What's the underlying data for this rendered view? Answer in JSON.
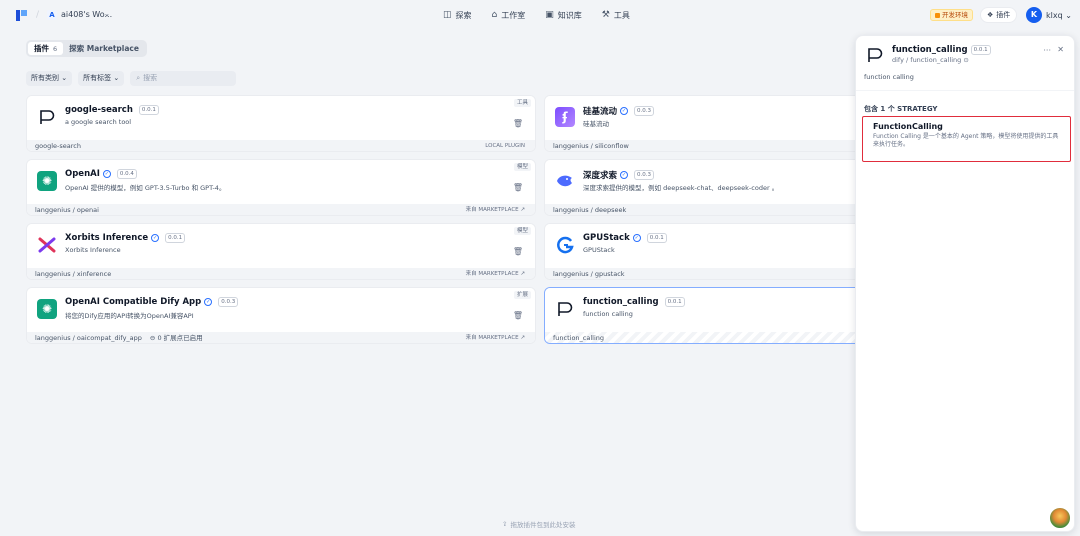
{
  "header": {
    "workspace_badge": "A",
    "workspace_name": "ai408's Wo...",
    "nav": [
      {
        "icon": "compass-icon",
        "label": "探索"
      },
      {
        "icon": "robot-icon",
        "label": "工作室"
      },
      {
        "icon": "book-icon",
        "label": "知识库"
      },
      {
        "icon": "tool-icon",
        "label": "工具"
      }
    ],
    "dev_env": "开发环境",
    "plugins_btn": "插件",
    "avatar_letter": "K",
    "username": "klxq"
  },
  "tabs": [
    {
      "label": "插件",
      "count": "6"
    },
    {
      "label": "探索 Marketplace",
      "count": ""
    }
  ],
  "filters": {
    "category": "所有类别",
    "tags": "所有标签",
    "search_placeholder": "搜索"
  },
  "cards": [
    {
      "title": "google-search",
      "version": "0.0.1",
      "verified": false,
      "desc": "a google search tool",
      "tag": "工具",
      "footer": "google-search",
      "source": "LOCAL PLUGIN",
      "icon": "p-logo-icon",
      "extra": ""
    },
    {
      "title": "硅基流动",
      "version": "0.0.3",
      "verified": true,
      "desc": "硅基流动",
      "tag": "",
      "footer": "langgenius / siliconflow",
      "source": "",
      "icon": "siliconflow-icon",
      "extra": ""
    },
    {
      "title": "OpenAI",
      "version": "0.0.4",
      "verified": true,
      "desc": "OpenAI 提供的模型，例如 GPT-3.5-Turbo 和 GPT-4。",
      "tag": "模型",
      "footer": "langgenius / openai",
      "source": "来自 MARKETPLACE ↗",
      "icon": "openai-icon",
      "extra": ""
    },
    {
      "title": "深度求索",
      "version": "0.0.3",
      "verified": true,
      "desc": "深度求索提供的模型，例如 deepseek-chat、deepseek-coder 。",
      "tag": "",
      "footer": "langgenius / deepseek",
      "source": "",
      "icon": "deepseek-icon",
      "extra": ""
    },
    {
      "title": "Xorbits Inference",
      "version": "0.0.1",
      "verified": true,
      "desc": "Xorbits Inference",
      "tag": "模型",
      "footer": "langgenius / xinference",
      "source": "来自 MARKETPLACE ↗",
      "icon": "xinference-icon",
      "extra": ""
    },
    {
      "title": "GPUStack",
      "version": "0.0.1",
      "verified": true,
      "desc": "GPUStack",
      "tag": "",
      "footer": "langgenius / gpustack",
      "source": "",
      "icon": "gpustack-icon",
      "extra": ""
    },
    {
      "title": "OpenAI Compatible Dify App",
      "version": "0.0.3",
      "verified": true,
      "desc": "将您的Dify应用的API转换为OpenAI兼容API",
      "tag": "扩展",
      "footer": "langgenius / oaicompat_dify_app",
      "source": "来自 MARKETPLACE ↗",
      "icon": "openai-icon",
      "extra": "0 扩展点已启用"
    },
    {
      "title": "function_calling",
      "version": "0.0.1",
      "verified": false,
      "desc": "function calling",
      "tag": "",
      "footer": "function_calling",
      "source": "",
      "icon": "p-logo-icon",
      "extra": ""
    }
  ],
  "panel": {
    "title": "function_calling",
    "version": "0.0.1",
    "subtitle": "dify / function_calling",
    "desc": "function calling",
    "section": "包含 1 个 STRATEGY",
    "strategy_name": "FunctionCalling",
    "strategy_desc": "Function Calling 是一个基本的 Agent 策略，模型将使用提供的工具来执行任务。"
  },
  "drop_hint": "拖放插件包到此处安装",
  "colors": {
    "accent": "#155eef",
    "highlight_border": "#e02d3c",
    "openai": "#10a37f",
    "siliconflow": "#7c4dff",
    "deepseek": "#4d6bfe"
  }
}
